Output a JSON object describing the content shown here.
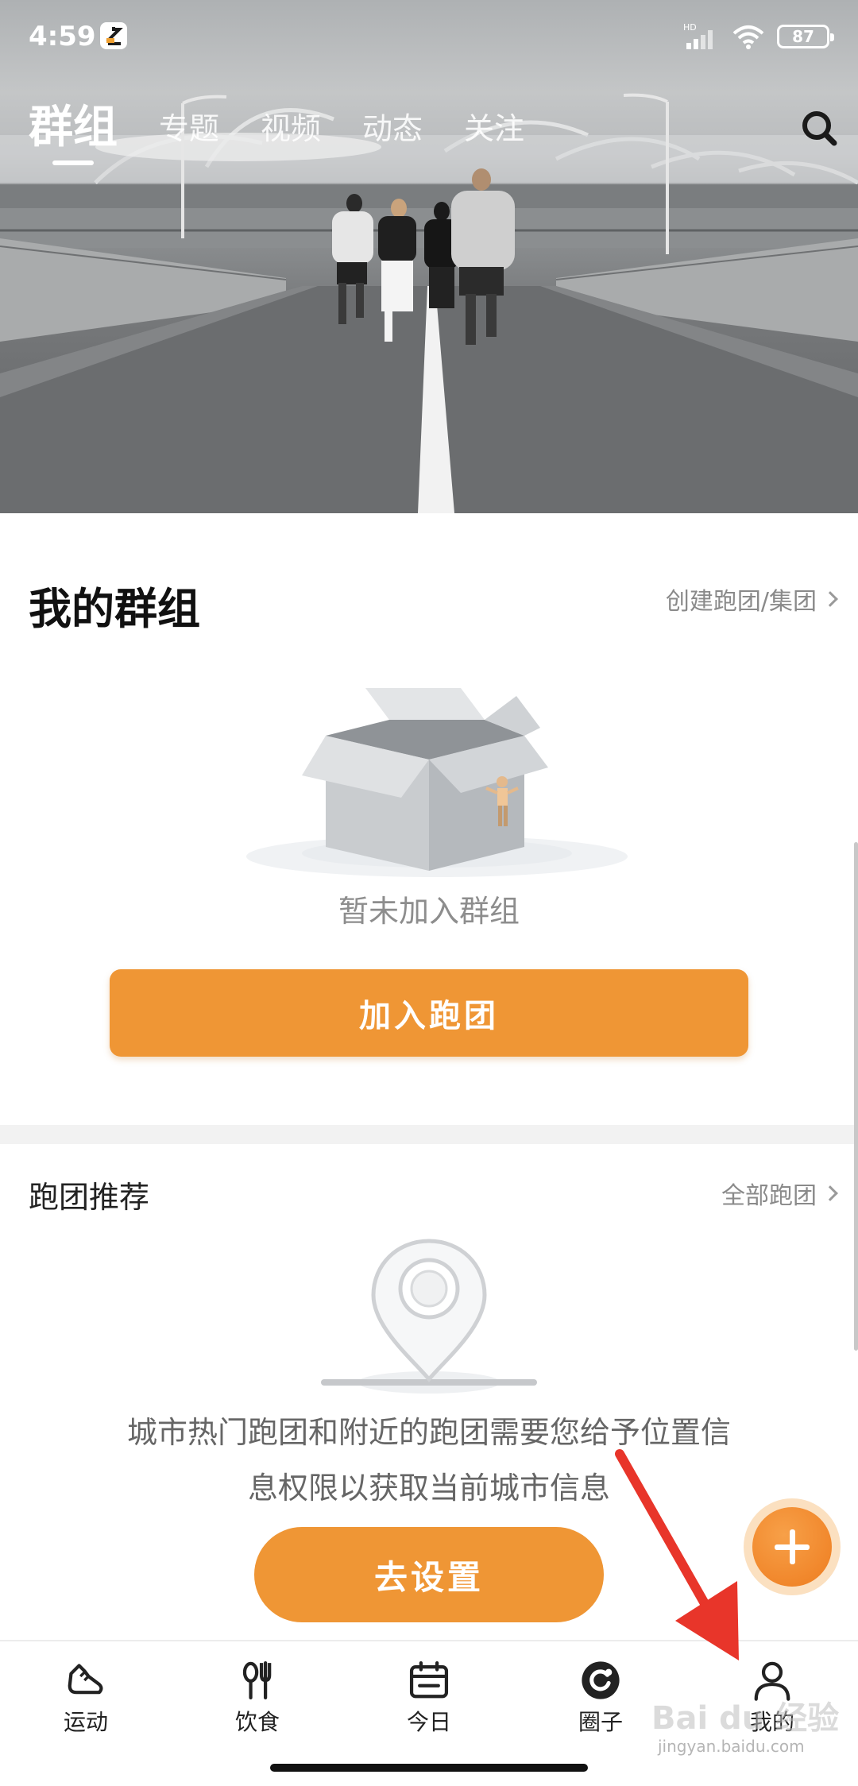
{
  "status_bar": {
    "time": "4:59",
    "network": "HD",
    "battery": "87"
  },
  "top_tabs": [
    {
      "label": "群组",
      "active": true
    },
    {
      "label": "专题",
      "active": false
    },
    {
      "label": "视频",
      "active": false
    },
    {
      "label": "动态",
      "active": false
    },
    {
      "label": "关注",
      "active": false
    }
  ],
  "my_group": {
    "title": "我的群组",
    "create_link": "创建跑团/集团",
    "empty_text": "暂未加入群组",
    "join_button": "加入跑团"
  },
  "recommend": {
    "title": "跑团推荐",
    "all_link": "全部跑团",
    "permission_line1": "城市热门跑团和附近的跑团需要您给予位置信",
    "permission_line2": "息权限以获取当前城市信息",
    "settings_button": "去设置"
  },
  "bottom_nav": [
    {
      "label": "运动",
      "icon": "shoe-icon"
    },
    {
      "label": "饮食",
      "icon": "fork-knife-icon"
    },
    {
      "label": "今日",
      "icon": "calendar-icon"
    },
    {
      "label": "圈子",
      "icon": "circle-refresh-icon"
    },
    {
      "label": "我的",
      "icon": "person-icon"
    }
  ],
  "watermark": {
    "text": "Bai du 经验",
    "sub": "jingyan.baidu.com"
  },
  "colors": {
    "accent": "#EF9635",
    "fab": "#EE7C1F",
    "annotation_arrow": "#E8352A"
  }
}
